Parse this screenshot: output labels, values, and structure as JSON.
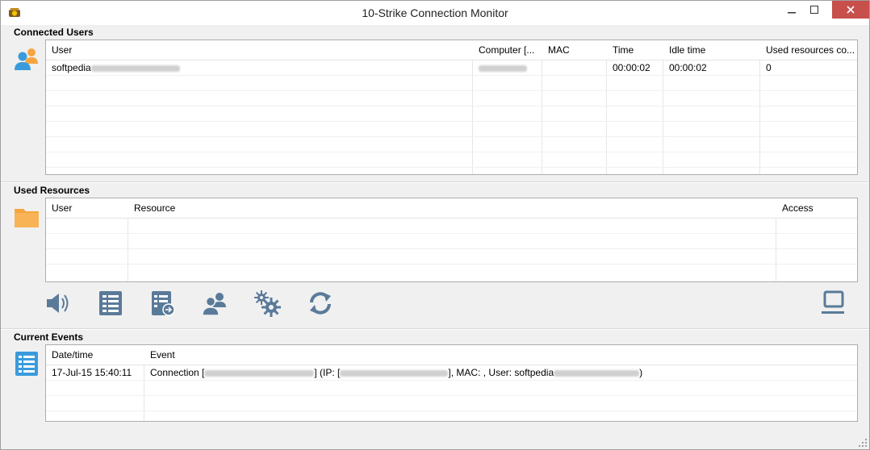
{
  "window": {
    "title": "10-Strike Connection Monitor"
  },
  "connected_users": {
    "label": "Connected Users",
    "columns": [
      "User",
      "Computer [...",
      "MAC",
      "Time",
      "Idle time",
      "Used resources co..."
    ],
    "rows": [
      {
        "user": "softpedia",
        "computer": "",
        "mac": "",
        "time": "00:00:02",
        "idle": "00:00:02",
        "used": "0"
      }
    ]
  },
  "used_resources": {
    "label": "Used Resources",
    "columns": [
      "User",
      "Resource",
      "Access"
    ]
  },
  "toolbar": {
    "icons": [
      "speaker-icon",
      "event-log-icon",
      "event-log-export-icon",
      "user-icon",
      "settings-icon",
      "refresh-icon",
      "computer-icon"
    ]
  },
  "current_events": {
    "label": "Current Events",
    "columns": [
      "Date/time",
      "Event"
    ],
    "rows": [
      {
        "datetime": "17-Jul-15 15:40:11",
        "event_prefix": "Connection [",
        "event_ip": "] (IP: [",
        "event_mac": "], MAC: , User: softpedia",
        "event_suffix": ")"
      }
    ]
  },
  "colors": {
    "accent_blue": "#3a9bdc",
    "orange": "#f5a540",
    "icon_gray": "#5a7a99"
  }
}
